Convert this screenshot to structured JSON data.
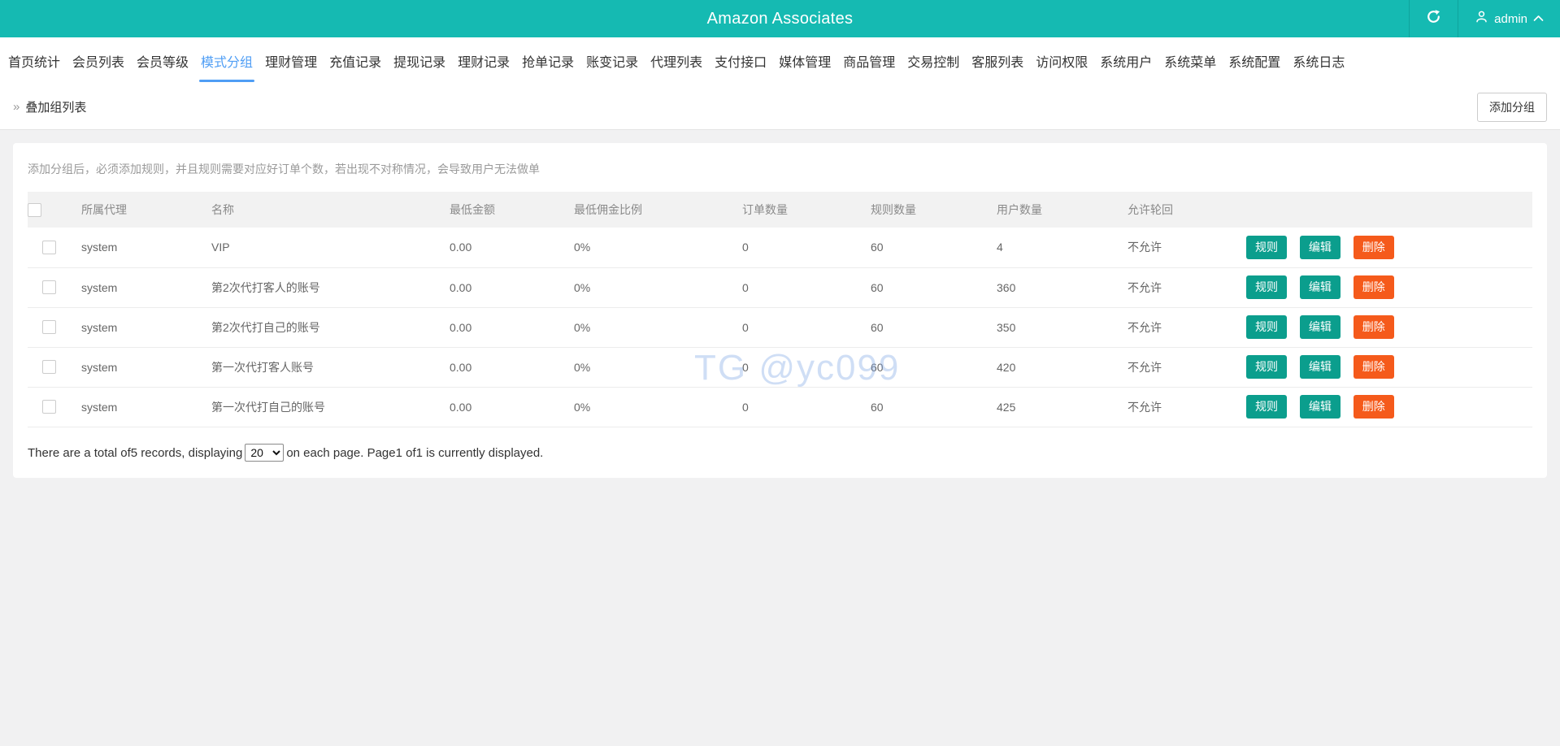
{
  "header": {
    "title": "Amazon Associates",
    "username": "admin"
  },
  "nav": {
    "items": [
      {
        "label": "首页统计",
        "active": false
      },
      {
        "label": "会员列表",
        "active": false
      },
      {
        "label": "会员等级",
        "active": false
      },
      {
        "label": "模式分组",
        "active": true
      },
      {
        "label": "理财管理",
        "active": false
      },
      {
        "label": "充值记录",
        "active": false
      },
      {
        "label": "提现记录",
        "active": false
      },
      {
        "label": "理财记录",
        "active": false
      },
      {
        "label": "抢单记录",
        "active": false
      },
      {
        "label": "账变记录",
        "active": false
      },
      {
        "label": "代理列表",
        "active": false
      },
      {
        "label": "支付接口",
        "active": false
      },
      {
        "label": "媒体管理",
        "active": false
      },
      {
        "label": "商品管理",
        "active": false
      },
      {
        "label": "交易控制",
        "active": false
      },
      {
        "label": "客服列表",
        "active": false
      },
      {
        "label": "访问权限",
        "active": false
      },
      {
        "label": "系统用户",
        "active": false
      },
      {
        "label": "系统菜单",
        "active": false
      },
      {
        "label": "系统配置",
        "active": false
      },
      {
        "label": "系统日志",
        "active": false
      }
    ]
  },
  "breadcrumb": {
    "label": "叠加组列表"
  },
  "toolbar": {
    "add_group_label": "添加分组"
  },
  "main": {
    "hint": "添加分组后，必须添加规则，并且规则需要对应好订单个数，若出现不对称情况，会导致用户无法做单",
    "table": {
      "columns": {
        "agent": "所属代理",
        "name": "名称",
        "min_amount": "最低金额",
        "min_commission_ratio": "最低佣金比例",
        "order_count": "订单数量",
        "rule_count": "规则数量",
        "user_count": "用户数量",
        "allow_loop": "允许轮回"
      },
      "actions": {
        "rule": "规则",
        "edit": "编辑",
        "delete": "删除"
      },
      "rows": [
        {
          "agent": "system",
          "name": "VIP",
          "min_amount": "0.00",
          "min_commission_ratio": "0%",
          "order_count": "0",
          "rule_count": "60",
          "user_count": "4",
          "allow_loop": "不允许"
        },
        {
          "agent": "system",
          "name": "第2次代打客人的账号",
          "min_amount": "0.00",
          "min_commission_ratio": "0%",
          "order_count": "0",
          "rule_count": "60",
          "user_count": "360",
          "allow_loop": "不允许"
        },
        {
          "agent": "system",
          "name": "第2次代打自己的账号",
          "min_amount": "0.00",
          "min_commission_ratio": "0%",
          "order_count": "0",
          "rule_count": "60",
          "user_count": "350",
          "allow_loop": "不允许"
        },
        {
          "agent": "system",
          "name": "第一次代打客人账号",
          "min_amount": "0.00",
          "min_commission_ratio": "0%",
          "order_count": "0",
          "rule_count": "60",
          "user_count": "420",
          "allow_loop": "不允许"
        },
        {
          "agent": "system",
          "name": "第一次代打自己的账号",
          "min_amount": "0.00",
          "min_commission_ratio": "0%",
          "order_count": "0",
          "rule_count": "60",
          "user_count": "425",
          "allow_loop": "不允许"
        }
      ]
    },
    "pagination": {
      "text_before": "There are a total of5 records, displaying",
      "page_size": "20",
      "text_after": "on each page. Page1 of1 is currently displayed.",
      "total_records": "5",
      "current_page": "1",
      "total_pages": "1"
    },
    "watermark": "TG @yc099"
  },
  "colors": {
    "header_teal": "#15bab2",
    "active_nav_blue": "#4f9ef5",
    "action_teal": "#0b9e8d",
    "action_orange": "#f55a1b",
    "watermark_blue": "#82a8e6"
  }
}
